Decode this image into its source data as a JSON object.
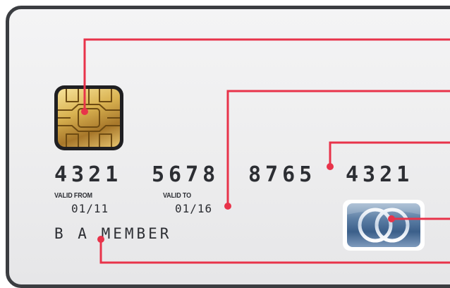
{
  "card": {
    "number_groups": [
      "4321",
      "5678",
      "8765",
      "4321"
    ],
    "valid_from_label": "VALID FROM",
    "valid_from_value": "01/11",
    "valid_to_label": "VALID TO",
    "valid_to_value": "01/16",
    "cardholder_name": "B A MEMBER"
  },
  "icons": {
    "chip": "emv-chip-icon",
    "contactless_logo": "card-scheme-logo-icon"
  },
  "colors": {
    "callout_line": "#e8334a",
    "card_border": "#3b3d41",
    "text": "#2c2e33",
    "chip_gold": "#d9b251",
    "logo_blue": "#3b5f8a"
  }
}
